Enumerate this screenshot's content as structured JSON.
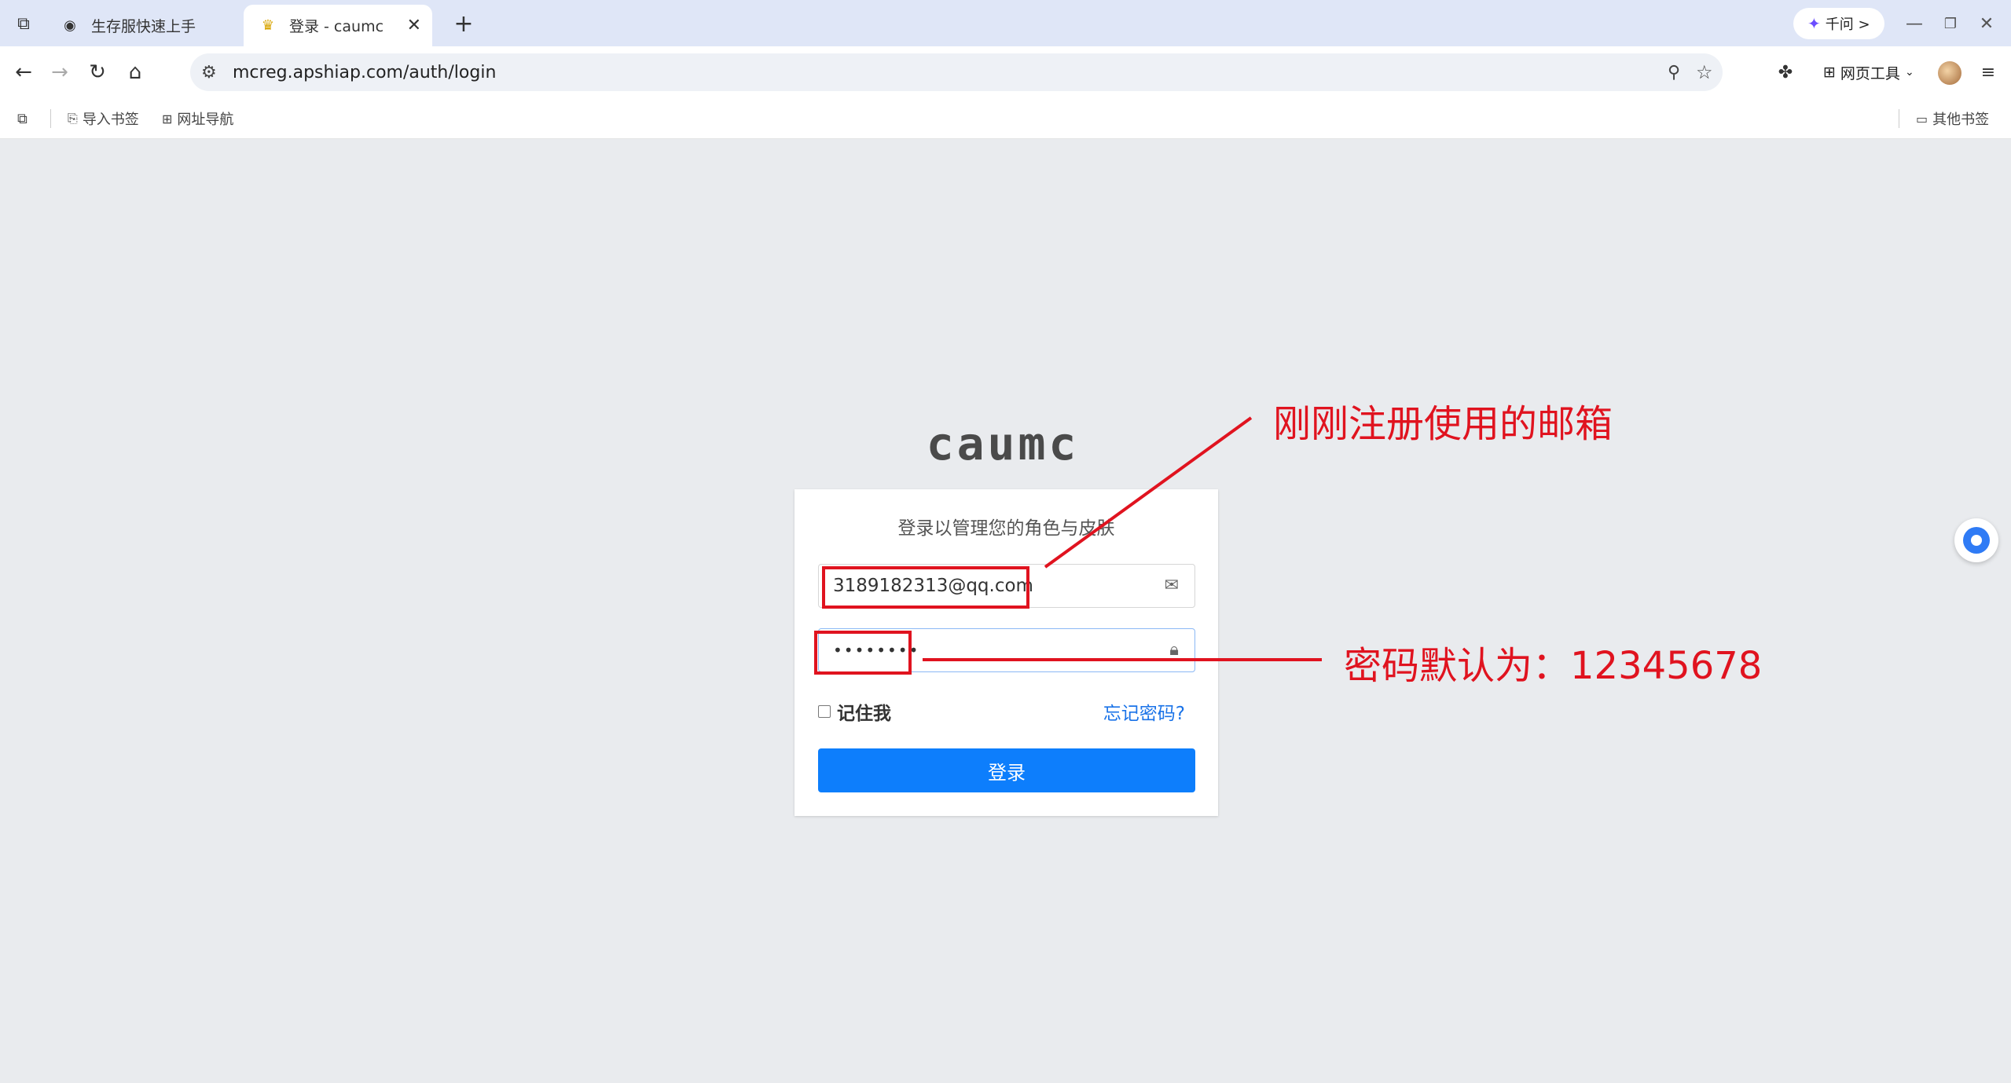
{
  "browser": {
    "tabs": [
      {
        "title": "生存服快速上手",
        "favicon": "globe-icon",
        "active": false
      },
      {
        "title": "登录 - caumc",
        "favicon": "shield-icon",
        "active": true
      }
    ],
    "qianwen_label": "千问 >",
    "url": "mcreg.apshiap.com/auth/login",
    "web_tools_label": "网页工具",
    "bookmarks": {
      "import": "导入书签",
      "nav": "网址导航",
      "other": "其他书签"
    }
  },
  "page": {
    "brand": "caumc",
    "subtitle": "登录以管理您的角色与皮肤",
    "email_value": "3189182313@qq.com",
    "password_value": "••••••••",
    "remember_label": "记住我",
    "forgot_label": "忘记密码?",
    "login_button": "登录"
  },
  "annotations": {
    "email_note": "刚刚注册使用的邮箱",
    "password_note": "密码默认为：12345678",
    "color": "#e0131f"
  }
}
